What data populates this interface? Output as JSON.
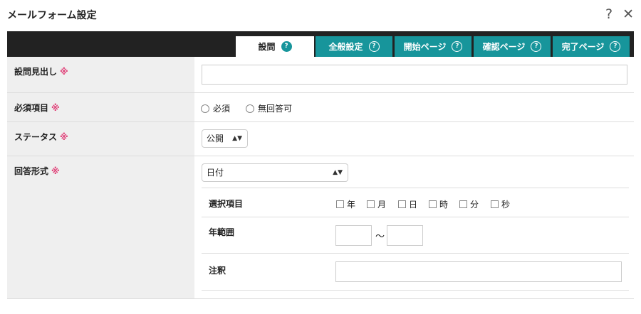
{
  "window": {
    "title": "メールフォーム設定",
    "help_icon": "?",
    "close_icon": "✕"
  },
  "tabs": [
    {
      "label": "設問",
      "active": true
    },
    {
      "label": "全般設定",
      "active": false
    },
    {
      "label": "開始ページ",
      "active": false
    },
    {
      "label": "確認ページ",
      "active": false
    },
    {
      "label": "完了ページ",
      "active": false
    }
  ],
  "tab_help_glyph": "?",
  "required_mark": "※",
  "fields": {
    "heading": {
      "label": "設問見出し",
      "value": ""
    },
    "required": {
      "label": "必須項目",
      "options": [
        "必須",
        "無回答可"
      ]
    },
    "status": {
      "label": "ステータス",
      "selected": "公開"
    },
    "answer_format": {
      "label": "回答形式",
      "selected": "日付",
      "select_items": {
        "label": "選択項目",
        "options": [
          "年",
          "月",
          "日",
          "時",
          "分",
          "秒"
        ]
      },
      "year_range": {
        "label": "年範囲",
        "separator": "〜",
        "from": "",
        "to": ""
      },
      "note": {
        "label": "注釈",
        "value": ""
      }
    }
  },
  "colors": {
    "tab_bg": "#17959b",
    "tabbar_bg": "#222222",
    "required": "#e0457b",
    "label_bg": "#efefef"
  }
}
